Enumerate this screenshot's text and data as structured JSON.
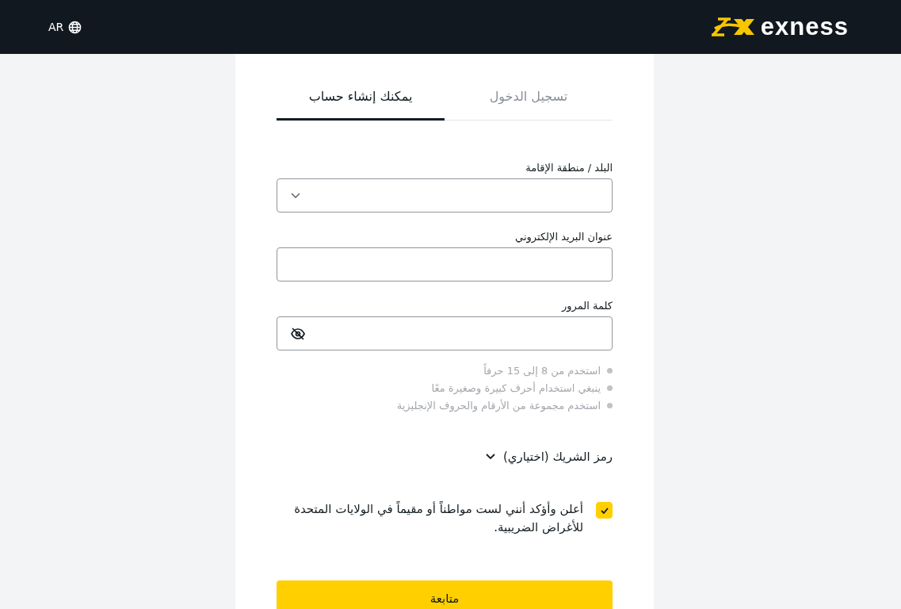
{
  "header": {
    "logo": "exness",
    "language": "AR"
  },
  "tabs": [
    {
      "label": "تسجيل الدخول",
      "selected": false
    },
    {
      "label": "يمكنك إنشاء حساب",
      "selected": true
    }
  ],
  "fields": [
    {
      "kind": "select",
      "label": "البلد / منطقة الإقامة"
    },
    {
      "kind": "text",
      "label": "عنوان البريد الإلكتروني"
    },
    {
      "kind": "password",
      "label": "كلمة المرور"
    }
  ],
  "password_hints": [
    "استخدم من 8 إلى 15 حرفاً",
    "ينبغي استخدام أحرف كبيرة وصغيرة معًا",
    "استخدم مجموعة من الأرقام والحروف الإنجليزية"
  ],
  "partner_code": {
    "label": "رمز الشريك (اختياري)",
    "expanded": false
  },
  "declaration": {
    "text": "أعلن وأؤكد أنني لست مواطناً أو مقيماً في الولايات المتحدة للأغراض الضريبية.",
    "checked": true
  },
  "submit": "متابعة"
}
